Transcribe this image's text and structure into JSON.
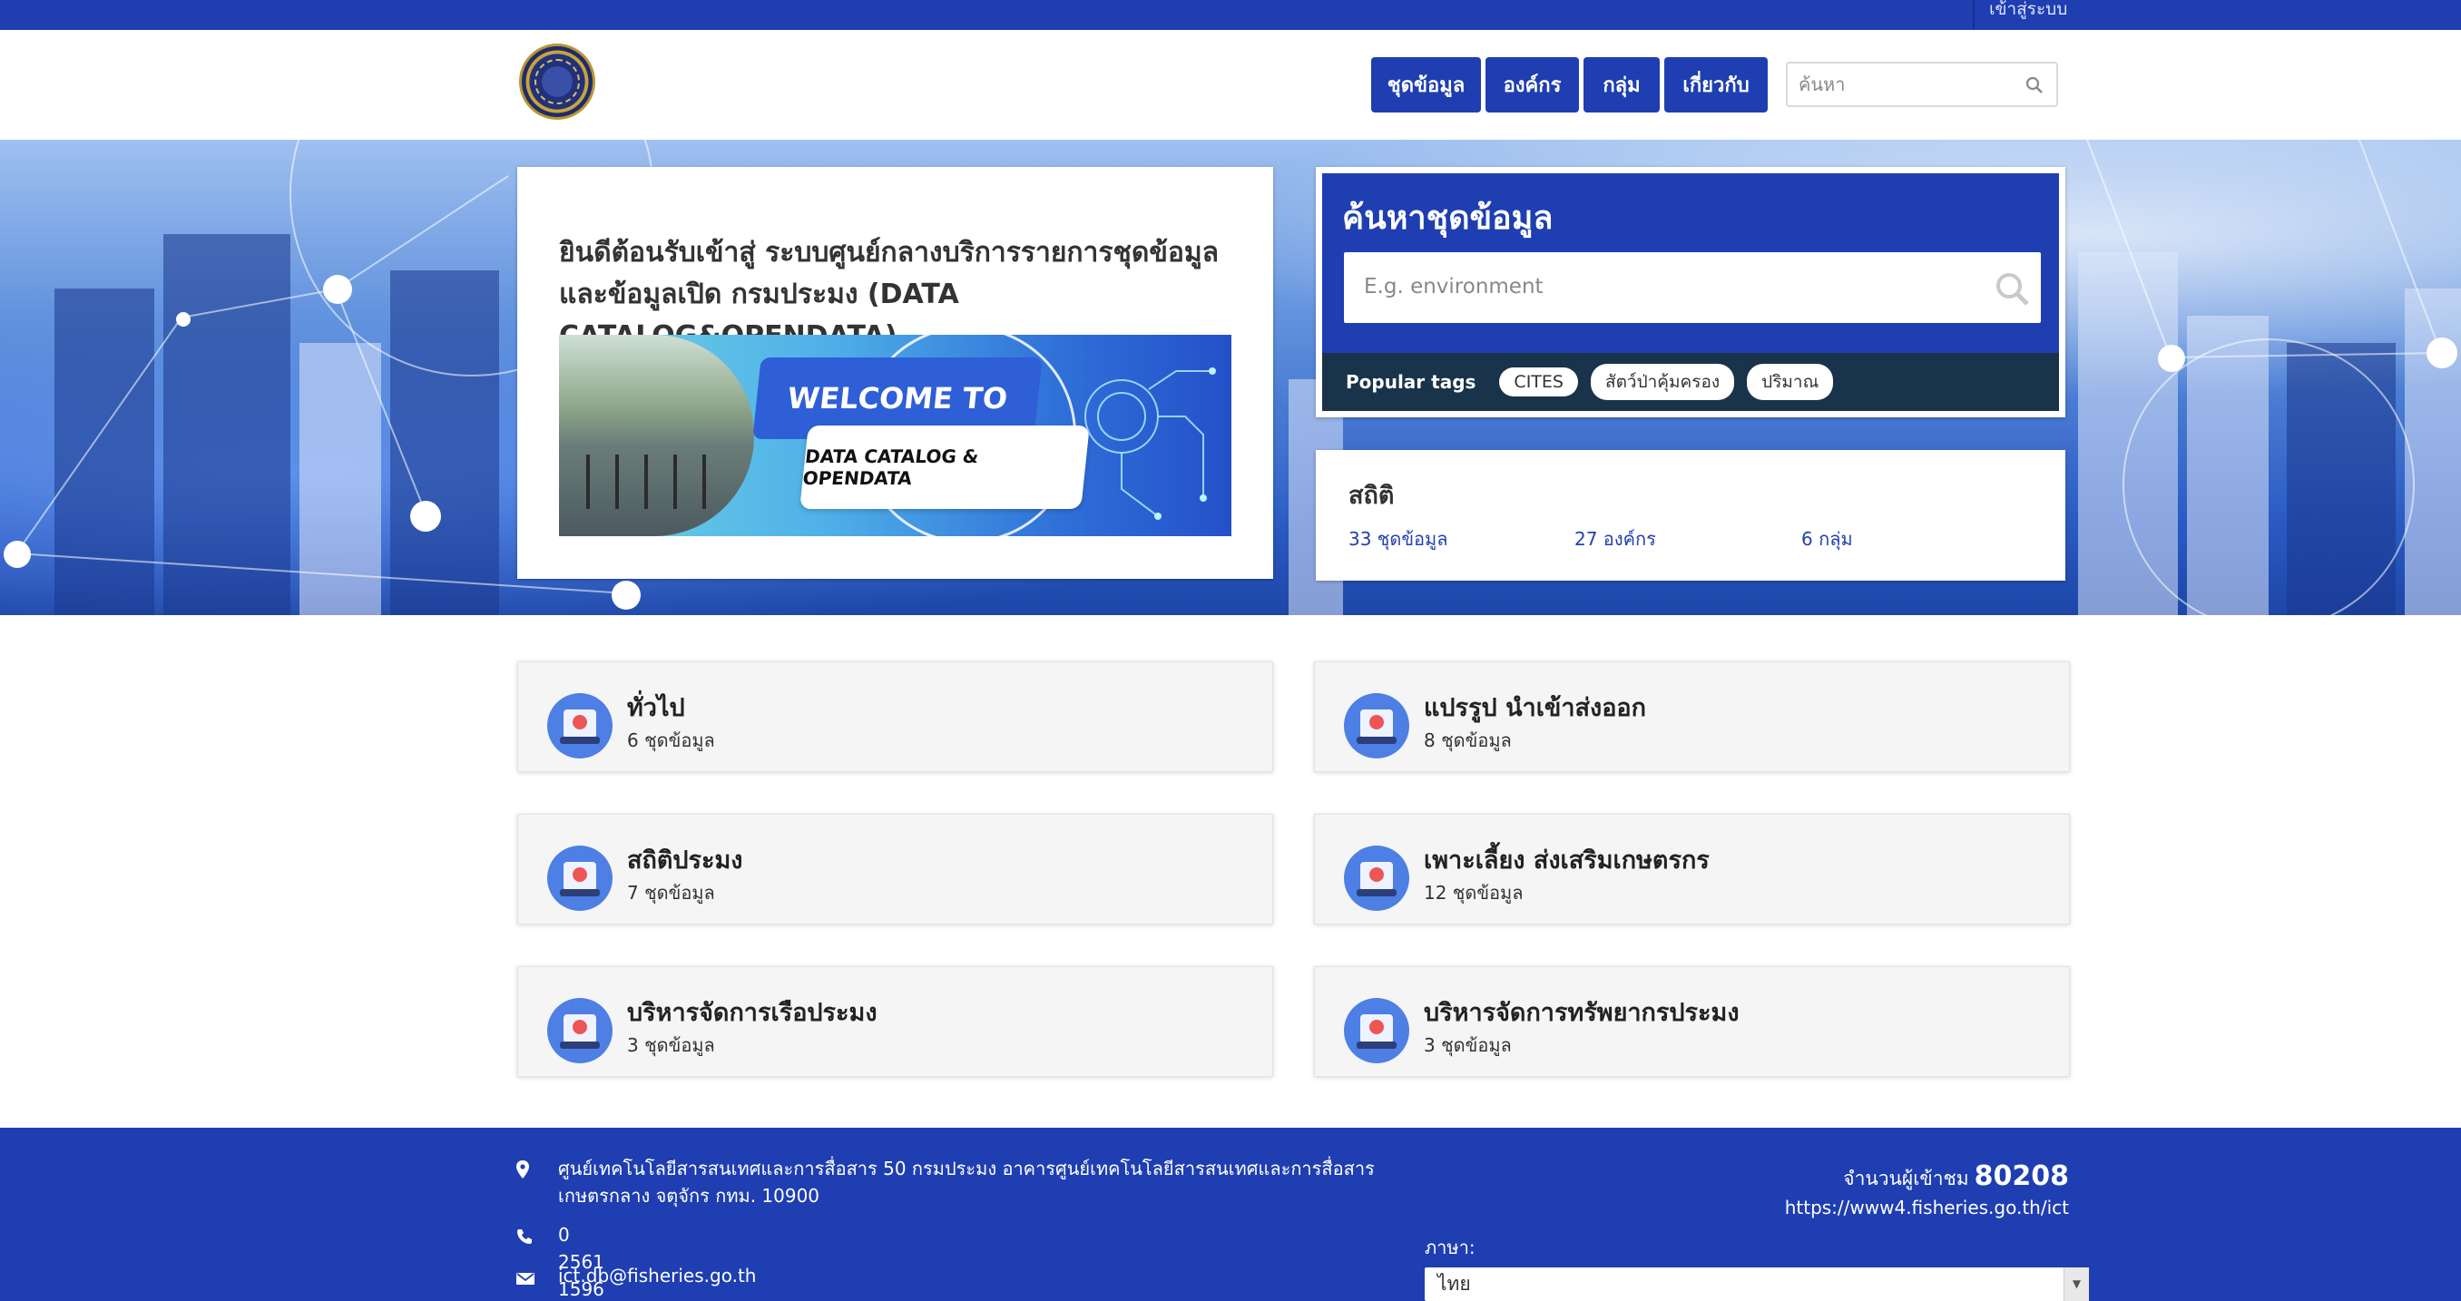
{
  "topbar": {
    "login_label": "เข้าสู่ระบบ"
  },
  "header": {
    "nav": [
      "ชุดข้อมูล",
      "องค์กร",
      "กลุ่ม",
      "เกี่ยวกับ"
    ],
    "search_placeholder": "ค้นหา"
  },
  "welcome": {
    "heading": "ยินดีต้อนรับเข้าสู่ ระบบศูนย์กลางบริการรายการชุดข้อมูลและข้อมูลเปิด กรมประมง (DATA CATALOG&OPENDATA)",
    "banner_line1": "WELCOME TO",
    "banner_line2": "DATA CATALOG & OPENDATA"
  },
  "search": {
    "title": "ค้นหาชุดข้อมูล",
    "placeholder": "E.g. environment",
    "popular_label": "Popular tags",
    "tags": [
      "CITES",
      "สัตว์ป่าคุ้มครอง",
      "ปริมาณ"
    ]
  },
  "stats": {
    "title": "สถิติ",
    "datasets": "33 ชุดข้อมูล",
    "organizations": "27 องค์กร",
    "groups": "6 กลุ่ม"
  },
  "groups": [
    {
      "title": "ทั่วไป",
      "count": "6 ชุดข้อมูล"
    },
    {
      "title": "แปรรูป นำเข้าส่งออก",
      "count": "8 ชุดข้อมูล"
    },
    {
      "title": "สถิติประมง",
      "count": "7 ชุดข้อมูล"
    },
    {
      "title": "เพาะเลี้ยง ส่งเสริมเกษตรกร",
      "count": "12 ชุดข้อมูล"
    },
    {
      "title": "บริหารจัดการเรือประมง",
      "count": "3 ชุดข้อมูล"
    },
    {
      "title": "บริหารจัดการทรัพยากรประมง",
      "count": "3 ชุดข้อมูล"
    }
  ],
  "footer": {
    "address": "ศูนย์เทคโนโลยีสารสนเทศและการสื่อสาร 50 กรมประมง อาคารศูนย์เทคโนโลยีสารสนเทศและการสื่อสาร เกษตรกลาง จตุจักร กทม. 10900",
    "phone": "0 2561 1596",
    "email": "ict.db@fisheries.go.th",
    "visitors_label": "จำนวนผู้เข้าชม",
    "visitors_count": "80208",
    "url": "https://www4.fisheries.go.th/ict",
    "language_label": "ภาษา:",
    "language_value": "ไทย"
  },
  "colors": {
    "primary": "#1e3eb1",
    "tag_bar": "#19334a",
    "link": "#2340b0"
  },
  "icons": {
    "header_search": "search-icon",
    "big_search": "search-icon",
    "address": "map-marker-icon",
    "phone": "phone-icon",
    "email": "envelope-icon"
  }
}
